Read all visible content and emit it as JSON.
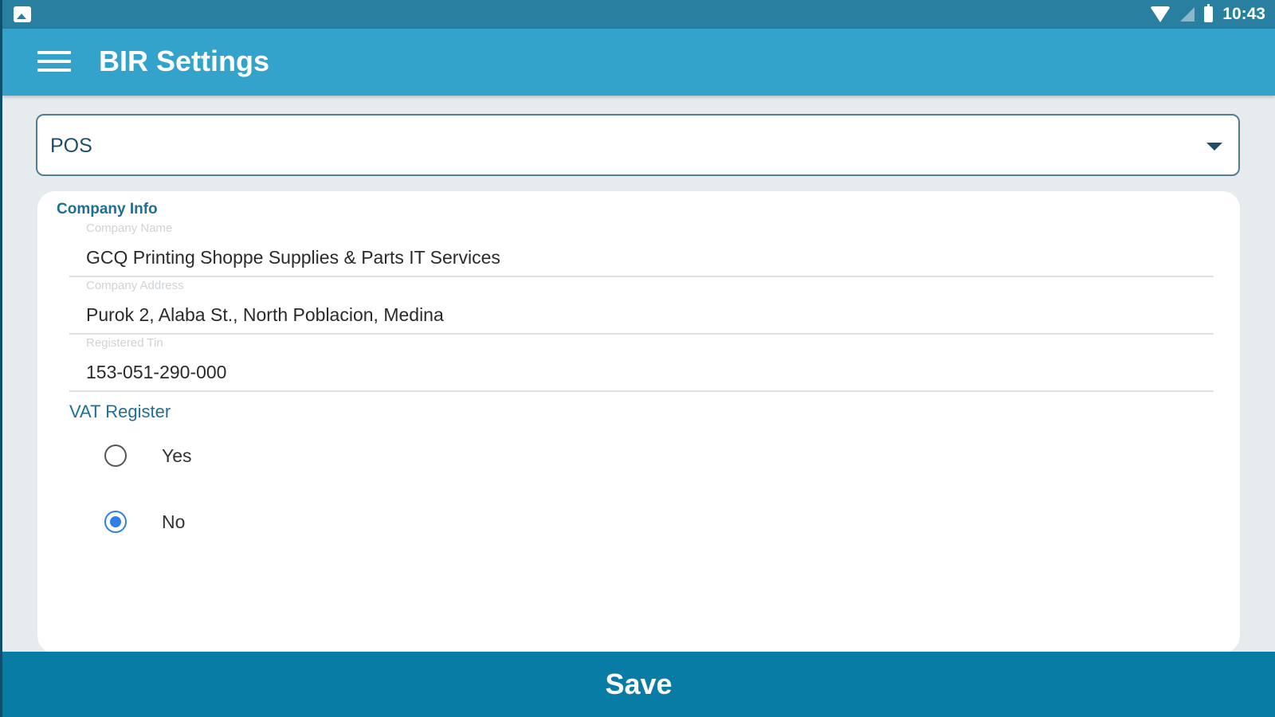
{
  "status_bar": {
    "time": "10:43"
  },
  "app_bar": {
    "title": "BIR Settings"
  },
  "selector": {
    "value": "POS"
  },
  "company_info": {
    "section_title": "Company Info",
    "fields": [
      {
        "label": "Company Name",
        "value": "GCQ Printing Shoppe Supplies & Parts IT Services"
      },
      {
        "label": "Company Address",
        "value": "Purok 2, Alaba St., North Poblacion, Medina"
      },
      {
        "label": "Registered Tin",
        "value": "153-051-290-000"
      }
    ],
    "vat": {
      "label": "VAT Register",
      "options": [
        {
          "label": "Yes",
          "selected": false
        },
        {
          "label": "No",
          "selected": true
        }
      ]
    }
  },
  "actions": {
    "save_label": "Save"
  },
  "colors": {
    "app_bar": "#33a3cb",
    "status_bar": "#287fa0",
    "save_button": "#087ca5",
    "accent_text": "#1f6f95",
    "radio_selected": "#2f7fe6"
  }
}
